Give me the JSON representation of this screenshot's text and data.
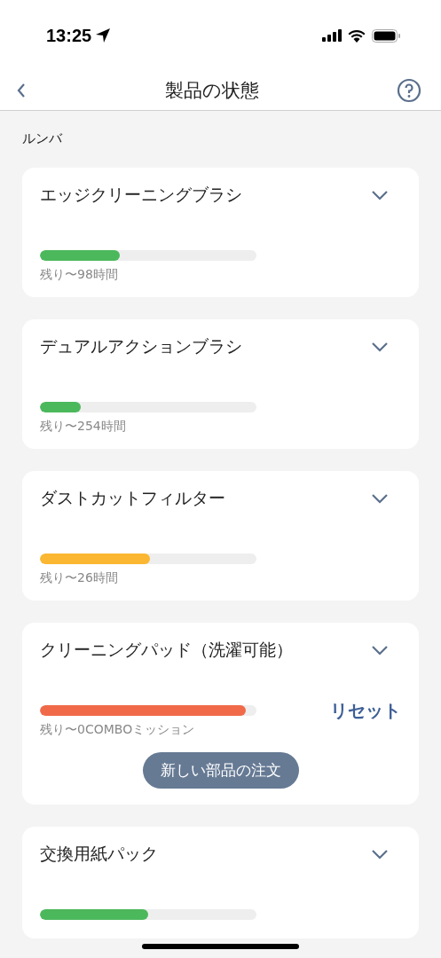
{
  "status_bar": {
    "time": "13:25"
  },
  "header": {
    "title": "製品の状態"
  },
  "section": "ルンバ",
  "parts": [
    {
      "name": "エッジクリーニングブラシ",
      "level": 0.37,
      "color": "#4cb85c",
      "remaining": "残り〜98時間",
      "expanded": false
    },
    {
      "name": "デュアルアクションブラシ",
      "level": 0.19,
      "color": "#4cb85c",
      "remaining": "残り〜254時間",
      "expanded": false
    },
    {
      "name": "ダストカットフィルター",
      "level": 0.51,
      "color": "#fbb731",
      "remaining": "残り〜26時間",
      "expanded": false
    },
    {
      "name": "クリーニングパッド（洗濯可能）",
      "level": 0.95,
      "color": "#f06a4a",
      "remaining": "残り〜0COMBOミッション",
      "expanded": false,
      "action": "リセット",
      "button": "新しい部品の注文"
    },
    {
      "name": "交換用紙パック",
      "level": 0.5,
      "color": "#4cb85c",
      "expanded": false
    }
  ]
}
